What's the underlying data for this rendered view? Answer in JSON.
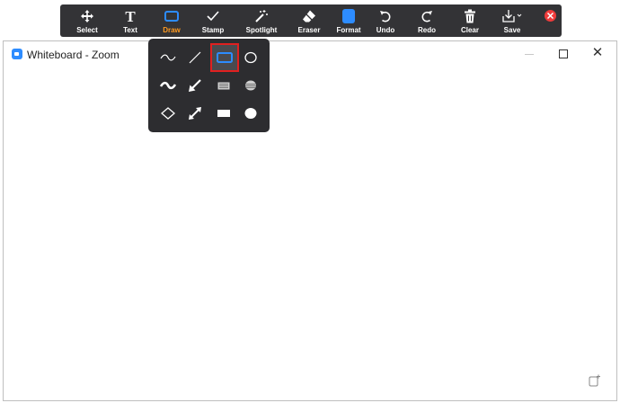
{
  "toolbar": {
    "tools": [
      {
        "label": "Select",
        "icon": "move-icon"
      },
      {
        "label": "Text",
        "icon": "text-icon"
      },
      {
        "label": "Draw",
        "icon": "rectangle-icon",
        "active": true
      },
      {
        "label": "Stamp",
        "icon": "checkmark-icon"
      },
      {
        "label": "Spotlight",
        "icon": "magic-wand-icon"
      },
      {
        "label": "Eraser",
        "icon": "eraser-icon"
      },
      {
        "label": "Format",
        "icon": "color-swatch-icon"
      },
      {
        "label": "Undo",
        "icon": "undo-icon"
      },
      {
        "label": "Redo",
        "icon": "redo-icon"
      },
      {
        "label": "Clear",
        "icon": "trash-icon"
      },
      {
        "label": "Save",
        "icon": "save-icon"
      }
    ],
    "exit_icon": "close-circle-icon"
  },
  "window": {
    "title": "Whiteboard - Zoom",
    "close_glyph": "✕"
  },
  "draw_menu": {
    "selected": "rectangle-outline",
    "shapes": [
      "freehand-thin",
      "line-thin",
      "rectangle-outline",
      "ellipse-outline",
      "freehand-thick",
      "arrow-line",
      "rectangle-semi-transparent",
      "ellipse-semi-transparent",
      "diamond-outline",
      "double-arrow",
      "rectangle-filled",
      "ellipse-filled"
    ]
  },
  "colors": {
    "toolbar_bg": "#333336",
    "active_label": "#ff9a1f",
    "accent_blue": "#2d8cff",
    "selection_border": "#e02020",
    "exit_red": "#ef3b3b"
  }
}
